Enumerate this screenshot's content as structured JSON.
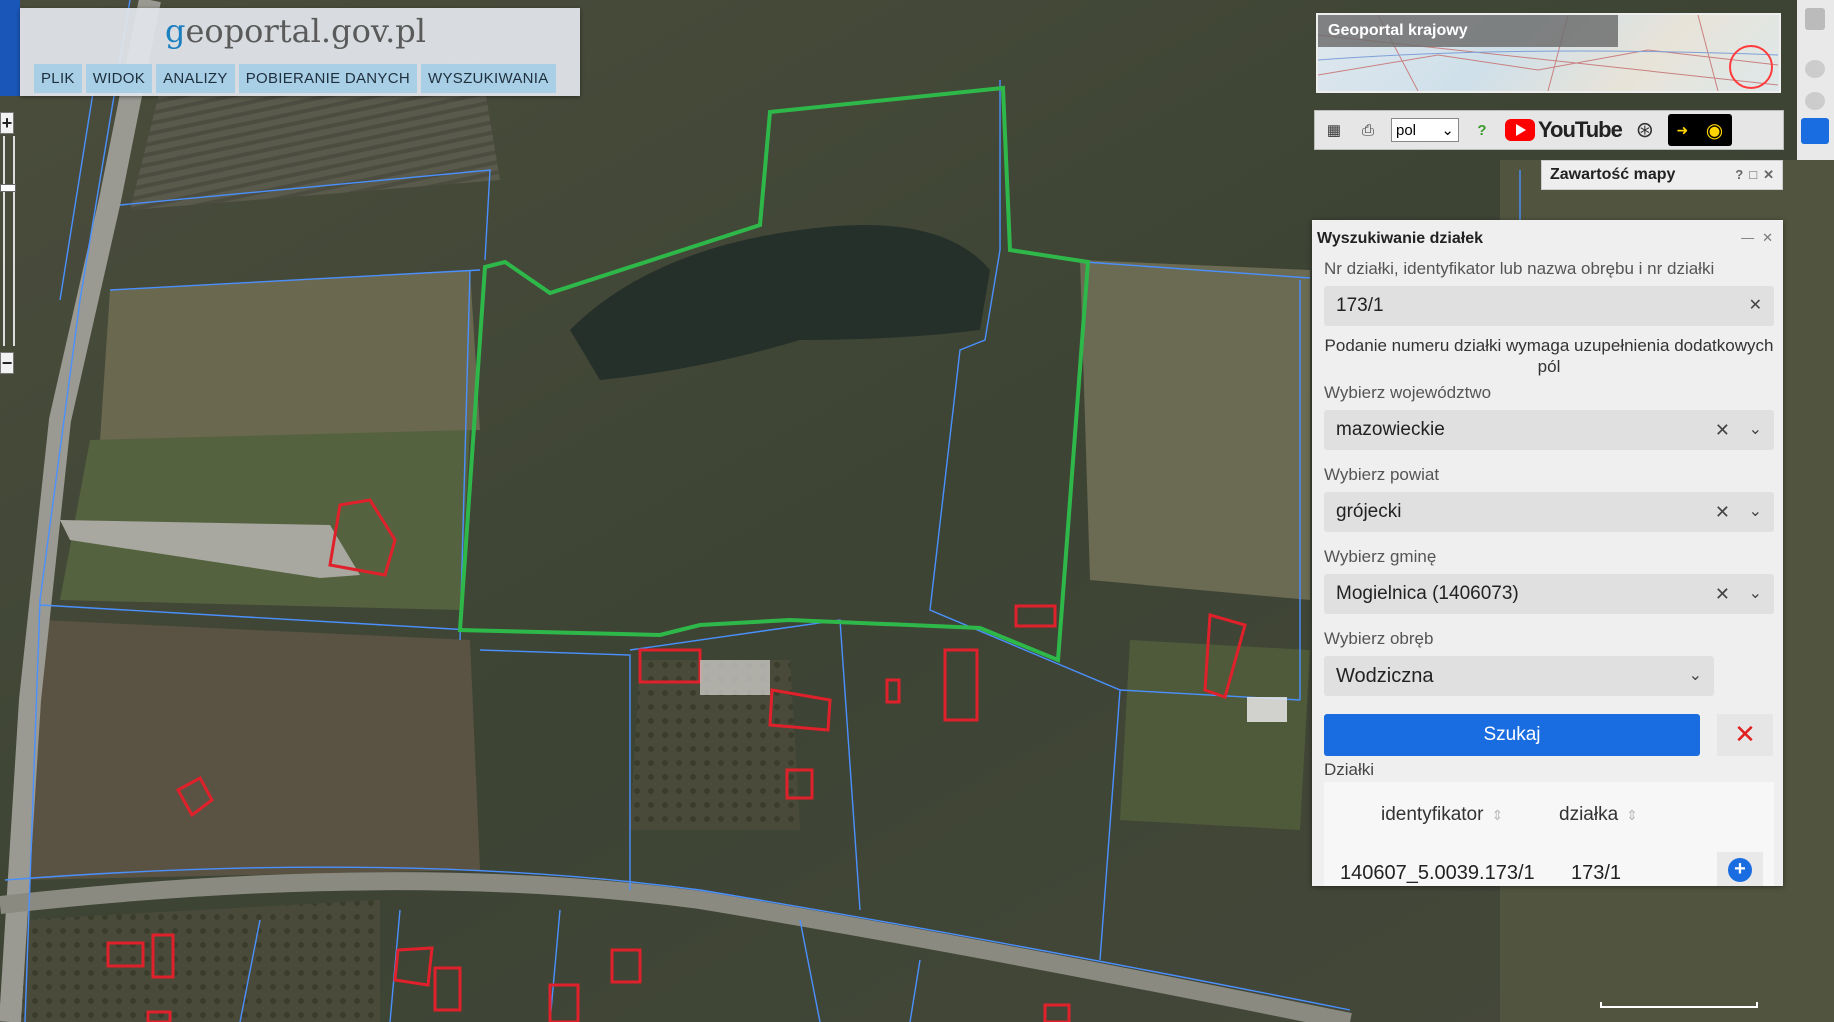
{
  "header": {
    "logo": "geoportal.gov.pl",
    "menu": [
      "PLIK",
      "WIDOK",
      "ANALIZY",
      "POBIERANIE DANYCH",
      "WYSZUKIWANIA"
    ]
  },
  "zoom": {
    "in": "+",
    "out": "−"
  },
  "overview": {
    "title": "Geoportal krajowy"
  },
  "toolbar": {
    "language": "pol",
    "youtube": "YouTube"
  },
  "map_content": {
    "title": "Zawartość mapy"
  },
  "search": {
    "title": "Wyszukiwanie działek",
    "parcel_label": "Nr działki, identyfikator lub nazwa obrębu i nr działki",
    "parcel_value": "173/1",
    "note": "Podanie numeru działki wymaga uzupełnienia dodatkowych pól",
    "voivodeship_label": "Wybierz województwo",
    "voivodeship_value": "mazowieckie",
    "county_label": "Wybierz powiat",
    "county_value": "grójecki",
    "commune_label": "Wybierz gminę",
    "commune_value": "Mogielnica (1406073)",
    "precinct_label": "Wybierz obręb",
    "precinct_value": "Wodziczna",
    "search_button": "Szukaj",
    "results_label": "Działki",
    "columns": [
      "identyfikator",
      "działka"
    ],
    "rows": [
      {
        "identyfikator": "140607_5.0039.173/1",
        "dzialka": "173/1"
      }
    ]
  },
  "colors": {
    "accent": "#1a6de0",
    "selected_parcel": "#2fb84a",
    "parcel_border": "#4a90ff",
    "buildings": "#e0202a"
  }
}
